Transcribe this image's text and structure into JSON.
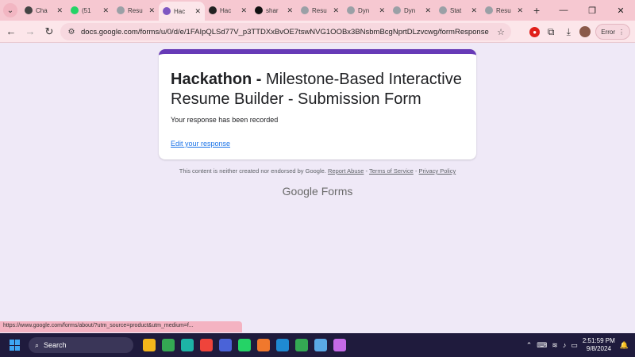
{
  "browser": {
    "tabs": [
      {
        "title": "Cha",
        "color": "#444444",
        "active": false
      },
      {
        "title": "(51",
        "color": "#25d366",
        "active": false
      },
      {
        "title": "Resu",
        "color": "#9aa0a6",
        "active": false
      },
      {
        "title": "Hac",
        "color": "#7e57c2",
        "active": true
      },
      {
        "title": "Hac",
        "color": "#222222",
        "active": false
      },
      {
        "title": "shar",
        "color": "#111111",
        "active": false
      },
      {
        "title": "Resu",
        "color": "#9aa0a6",
        "active": false
      },
      {
        "title": "Dyn",
        "color": "#9aa0a6",
        "active": false
      },
      {
        "title": "Dyn",
        "color": "#9aa0a6",
        "active": false
      },
      {
        "title": "Stat",
        "color": "#9aa0a6",
        "active": false
      },
      {
        "title": "Resu",
        "color": "#9aa0a6",
        "active": false
      }
    ],
    "url": "docs.google.com/forms/u/0/d/e/1FAIpQLSd77V_p3TTDXxBvOE7tswNVG1OOBx3BNsbmBcgNprtDLzvcwg/formResponse",
    "error_label": "Error",
    "status_url": "https://www.google.com/forms/about/?utm_source=product&utm_medium=f..."
  },
  "form": {
    "title_bold": "Hackathon -",
    "title_rest": " Milestone-Based Interactive Resume Builder - Submission Form",
    "confirmation": "Your response has been recorded",
    "edit_link": "Edit your response"
  },
  "footer": {
    "disclaimer": "This content is neither created nor endorsed by Google.",
    "report_abuse": "Report Abuse",
    "terms": "Terms of Service",
    "privacy": "Privacy Policy",
    "sep": "-",
    "logo_google": "Google",
    "logo_forms": "Forms"
  },
  "taskbar": {
    "search_label": "Search",
    "time": "2:51:59 PM",
    "date": "9/8/2024",
    "apps": [
      {
        "name": "file-explorer",
        "color": "#f3b51b"
      },
      {
        "name": "chrome",
        "color": "#34a853"
      },
      {
        "name": "edge",
        "color": "#1db4a6"
      },
      {
        "name": "anydesk",
        "color": "#ef443b"
      },
      {
        "name": "code-tool",
        "color": "#4a63d8"
      },
      {
        "name": "whatsapp",
        "color": "#25d366"
      },
      {
        "name": "media-app",
        "color": "#f0782d"
      },
      {
        "name": "vscode",
        "color": "#1f8ad2"
      },
      {
        "name": "chrome-active",
        "color": "#34a853"
      },
      {
        "name": "notepad",
        "color": "#5aa9e6"
      },
      {
        "name": "git-app",
        "color": "#c46ae6"
      }
    ]
  }
}
